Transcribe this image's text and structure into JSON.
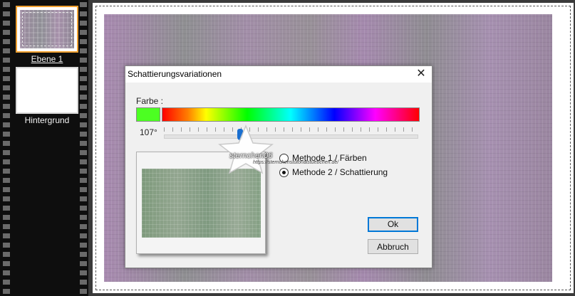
{
  "layers": [
    {
      "name": "Ebene 1",
      "selected": true
    },
    {
      "name": "Hintergrund",
      "selected": false
    }
  ],
  "dialog": {
    "title": "Schattierungsvariationen",
    "close_glyph": "✕",
    "color_label": "Farbe :",
    "color_hex": "#4cff22",
    "hue_value": "107°",
    "methods": [
      {
        "label": "Methode 1 / Färben",
        "selected": false
      },
      {
        "label": "Methode 2 / Schattierung",
        "selected": true
      }
    ],
    "ok_label": "Ok",
    "cancel_label": "Abbruch"
  },
  "watermark": {
    "name": "sternchen06",
    "url": "https://sternchenstutorialstuebchen.de/"
  },
  "colors": {
    "selection": "#f0a030",
    "accent": "#0078d7",
    "slider_thumb": "#1a6fd0"
  }
}
